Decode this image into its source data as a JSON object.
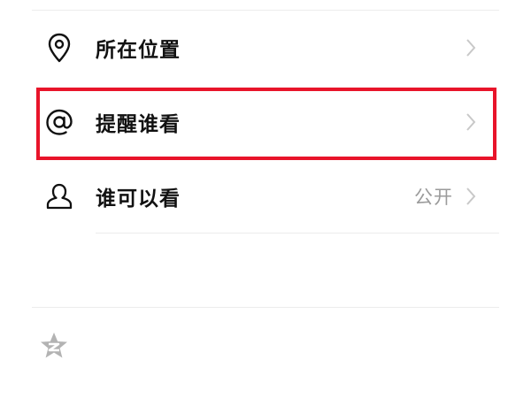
{
  "menu": {
    "location": {
      "label": "所在位置",
      "icon": "location-pin-icon"
    },
    "remind": {
      "label": "提醒谁看",
      "icon": "at-icon"
    },
    "visibility": {
      "label": "谁可以看",
      "value": "公开",
      "icon": "person-icon"
    }
  },
  "colors": {
    "highlight": "#e8142a",
    "divider": "#ececec",
    "label": "#111111",
    "secondary": "#9b9b9b",
    "chevron": "#c8c8c8"
  },
  "footer": {
    "icon": "qzone-star-icon"
  }
}
